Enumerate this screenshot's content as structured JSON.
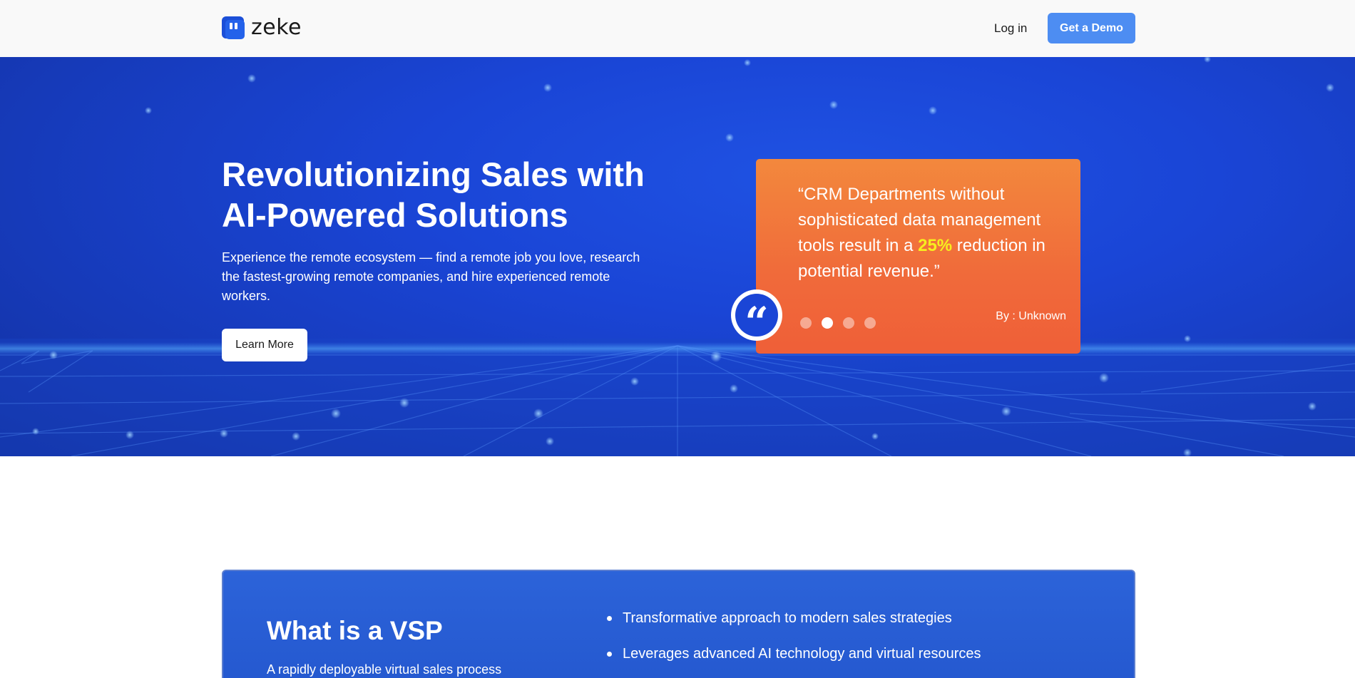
{
  "header": {
    "logo_text": "zeke",
    "login_label": "Log in",
    "demo_label": "Get a Demo"
  },
  "hero": {
    "title": "Revolutionizing Sales with AI-Powered Solutions",
    "subtitle": "Experience the remote ecosystem — find a remote job you love, research the fastest-growing remote companies, and hire experienced remote workers.",
    "cta_label": "Learn More"
  },
  "testimonial": {
    "quote_before": "“CRM Departments without sophisticated data management tools result in a ",
    "quote_highlight": "25%",
    "quote_after": " reduction in potential revenue.”",
    "author": "By : Unknown",
    "slides": 4,
    "active_slide": 2
  },
  "vsp": {
    "title": "What is a VSP",
    "description": "A rapidly deployable virtual sales process",
    "bullets": [
      "Transformative approach to modern sales strategies",
      "Leverages advanced AI technology and virtual resources"
    ]
  },
  "colors": {
    "primary_button": "#4d8df2",
    "hero_bg": "#1a45d6",
    "quote_card": "#f06a3a",
    "highlight": "#f7ee1e"
  }
}
